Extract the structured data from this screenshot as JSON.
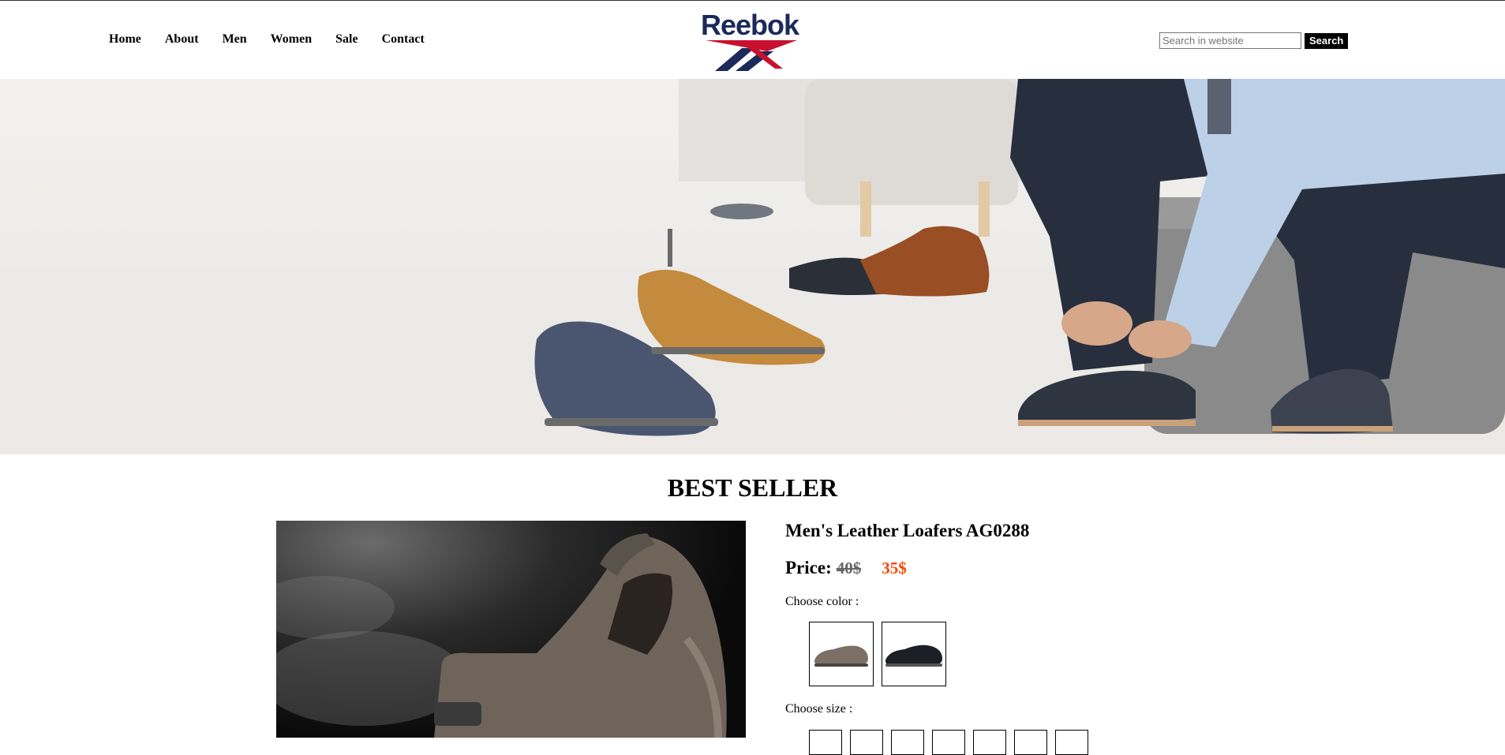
{
  "header": {
    "nav": [
      "Home",
      "About",
      "Men",
      "Women",
      "Sale",
      "Contact"
    ],
    "logo_text": "Reebok",
    "search_placeholder": "Search in website",
    "search_button": "Search"
  },
  "section": {
    "title": "BEST SELLER"
  },
  "product": {
    "name": "Men's Leather Loafers AG0288",
    "price_label": "Price:",
    "price_old": "40$",
    "price_new": "35$",
    "choose_color_label": "Choose color :",
    "colors": [
      "grey",
      "black"
    ],
    "choose_size_label": "Choose size :"
  },
  "colors": {
    "brand_navy": "#1b2a5a",
    "brand_red": "#c8102e",
    "sale_red": "#ff4500"
  }
}
